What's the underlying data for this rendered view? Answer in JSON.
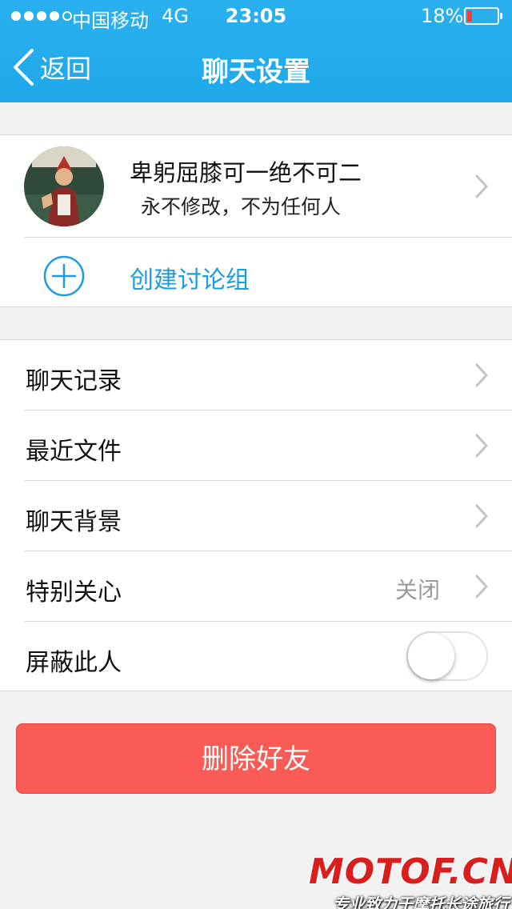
{
  "status_bar": {
    "carrier": "中国移动",
    "network": "4G",
    "time": "23:05",
    "battery_percent": "18%",
    "battery_level": 0.18,
    "battery_color": "#ff3b30"
  },
  "nav": {
    "back_label": "返回",
    "title": "聊天设置",
    "icon": "chevron-left-icon"
  },
  "profile": {
    "name": "卑躬屈膝可一绝不可二",
    "signature": "永不修改，不为任何人",
    "create_group_label": "创建讨论组",
    "create_group_icon": "plus-circle-icon"
  },
  "settings": {
    "items": [
      {
        "label": "聊天记录",
        "value": ""
      },
      {
        "label": "最近文件",
        "value": ""
      },
      {
        "label": "聊天背景",
        "value": ""
      },
      {
        "label": "特别关心",
        "value": "关闭"
      },
      {
        "label": "屏蔽此人",
        "toggle": false
      }
    ]
  },
  "delete_button": {
    "label": "删除好友",
    "color": "#fb5b55"
  },
  "watermark": {
    "brand": "MOTOF.CN",
    "slogan": "专业致力于摩托长途旅行"
  },
  "colors": {
    "header": "#1ea8ea",
    "accent": "#1b9ce0"
  }
}
